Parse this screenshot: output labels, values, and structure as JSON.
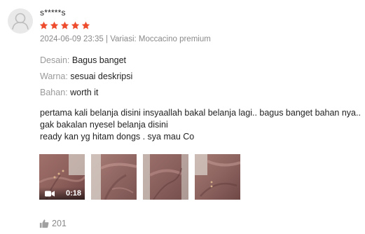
{
  "review": {
    "username": "s*****s",
    "rating": 5,
    "rating_max": 5,
    "date": "2024-06-09 23:35",
    "separator": " | ",
    "variation_label": "Variasi: ",
    "variation_value": "Moccacino premium",
    "attributes": [
      {
        "label": "Desain:",
        "value": "Bagus banget"
      },
      {
        "label": "Warna:",
        "value": "sesuai deskripsi"
      },
      {
        "label": "Bahan:",
        "value": "worth it"
      }
    ],
    "comment_lines": [
      "pertama kali belanja disini insyaallah bakal belanja lagi.. bagus banget bahan nya..",
      "gak bakalan nyesel belanja disini",
      "ready kan yg hitam dongs . sya mau Co"
    ],
    "video_duration": "0:18",
    "likes": "201"
  },
  "colors": {
    "star": "#ee4d2d",
    "muted_text": "#8a8a8a",
    "body_text": "#222222",
    "avatar_bg": "#e9e9e9"
  },
  "icons": {
    "avatar": "user-silhouette-icon",
    "star": "star-icon",
    "video": "video-camera-icon",
    "like": "thumbs-up-icon"
  }
}
